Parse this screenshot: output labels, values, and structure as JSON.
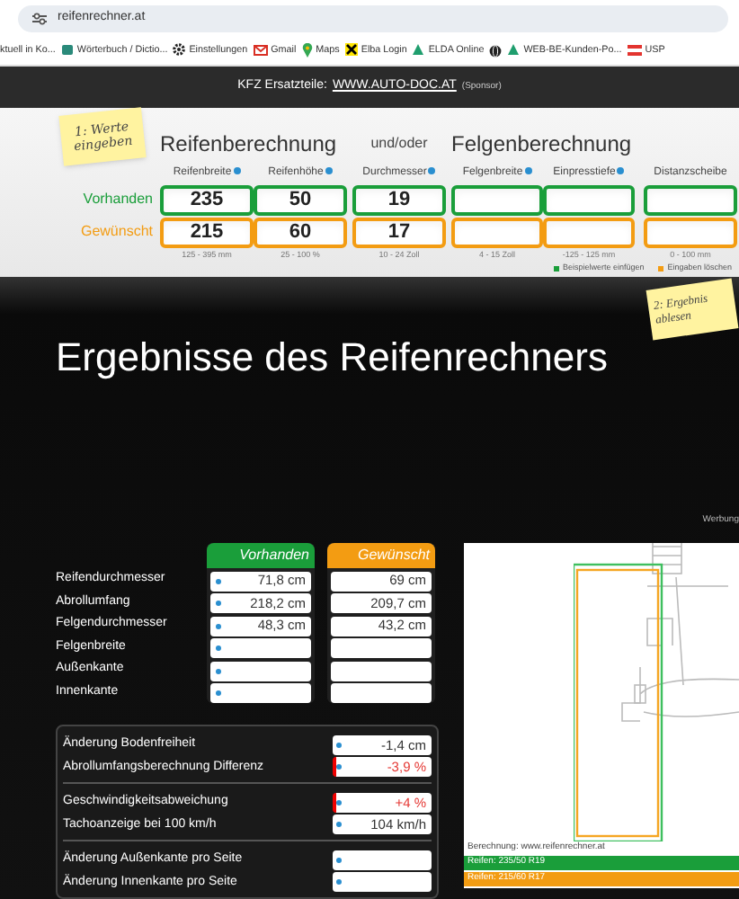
{
  "browser": {
    "url": "reifenrechner.at",
    "bookmarks": [
      {
        "label": "ktuell in Ko..."
      },
      {
        "label": "Wörterbuch / Dictio...",
        "kind": "square"
      },
      {
        "label": "Einstellungen",
        "kind": "gear"
      },
      {
        "label": "Gmail",
        "kind": "mail"
      },
      {
        "label": "Maps",
        "kind": "pin"
      },
      {
        "label": "Elba Login",
        "kind": "x"
      },
      {
        "label": "ELDA Online",
        "kind": "triangle"
      },
      {
        "kind": "globe"
      },
      {
        "label": "WEB-BE-Kunden-Po...",
        "kind": "triangle"
      },
      {
        "label": "USP",
        "kind": "flag"
      }
    ]
  },
  "sponsor": {
    "prefix": "KFZ Ersatzteile:",
    "link": "WWW.AUTO-DOC.AT",
    "suffix": "(Sponsor)"
  },
  "calculator": {
    "note": "1: Werte eingeben",
    "headings": [
      {
        "text": "Reifenberechnung",
        "kind": "title"
      },
      {
        "text": "und/oder",
        "kind": "connector"
      },
      {
        "text": "Felgenberechnung",
        "kind": "title"
      }
    ],
    "columns": [
      {
        "label": "Reifenbreite",
        "info": true,
        "hint": "125 - 395 mm"
      },
      {
        "label": "Reifenhöhe",
        "info": true,
        "hint": "25 - 100 %"
      },
      {
        "label": "Durchmesser",
        "info": true,
        "hint": "10 - 24 Zoll"
      },
      {
        "label": "Felgenbreite",
        "info": true,
        "hint": "4 - 15 Zoll"
      },
      {
        "label": "Einpresstiefe",
        "info": true,
        "hint": "-125 - 125 mm"
      },
      {
        "label": "Distanzscheibe",
        "info": false,
        "hint": "0 - 100 mm"
      }
    ],
    "rows": [
      {
        "label": "Vorhanden",
        "kind": "current",
        "values": [
          "235",
          "50",
          "19"
        ]
      },
      {
        "label": "Gewünscht",
        "kind": "desired",
        "values": [
          "215",
          "60",
          "17"
        ]
      }
    ],
    "legend": [
      {
        "label": "Beispielwerte einfügen",
        "color": "#1a9e3a"
      },
      {
        "label": "Eingaben löschen",
        "color": "#f39c12"
      }
    ]
  },
  "results": {
    "title": "Ergebnisse des Reifenrechners",
    "note": "2: Ergebnis ablesen",
    "ad_label": "Werbung",
    "columns": [
      {
        "label": "Vorhanden",
        "kind": "current"
      },
      {
        "label": "Gewünscht",
        "kind": "desired"
      }
    ],
    "rows": [
      {
        "label": "Reifendurchmesser",
        "values": [
          "71,8 cm",
          "69 cm"
        ]
      },
      {
        "label": "Abrollumfang",
        "values": [
          "218,2 cm",
          "209,7 cm"
        ]
      },
      {
        "label": "Felgendurchmesser",
        "values": [
          "48,3 cm",
          "43,2 cm"
        ]
      },
      {
        "label": "Felgenbreite"
      },
      {
        "label": "Außenkante"
      },
      {
        "label": "Innenkante"
      }
    ],
    "groups": [
      {
        "rows": [
          {
            "label": "Änderung Bodenfreiheit",
            "value": "-1,4 cm",
            "warning": false
          },
          {
            "label": "Abrollumfangsberechnung Differenz",
            "value": "-3,9 %",
            "warning": true
          }
        ]
      },
      {
        "rows": [
          {
            "label": "Geschwindigkeitsabweichung",
            "value": "+4 %",
            "warning": true
          },
          {
            "label": "Tachoanzeige bei 100 km/h",
            "value": "104 km/h",
            "warning": false
          }
        ]
      },
      {
        "rows": [
          {
            "label": "Änderung Außenkante pro Seite",
            "warning": false
          },
          {
            "label": "Änderung Innenkante pro Seite",
            "warning": false
          }
        ]
      }
    ],
    "figure": {
      "caption": "Berechnung: www.reifenrechner.at",
      "tires": [
        {
          "text": "Reifen: 235/50 R19",
          "kind": "current"
        },
        {
          "text": "Reifen: 215/60 R17",
          "kind": "desired"
        }
      ]
    }
  }
}
